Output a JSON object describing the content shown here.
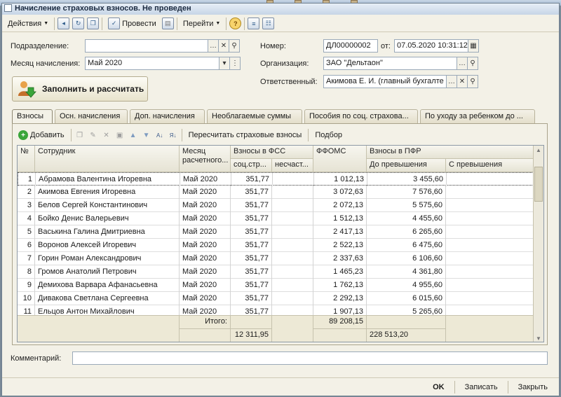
{
  "window": {
    "title": "Начисление страховых взносов. Не проведен"
  },
  "toolbar": {
    "actions_label": "Действия",
    "post_label": "Провести",
    "goto_label": "Перейти",
    "help_label": "?"
  },
  "form": {
    "division_label": "Подразделение:",
    "division_value": "",
    "month_label": "Месяц начисления:",
    "month_value": "Май 2020",
    "number_label": "Номер:",
    "number_value": "ДЛ00000002",
    "from_label": "от:",
    "date_value": "07.05.2020 10:31:12",
    "org_label": "Организация:",
    "org_value": "ЗАО \"Дельтаон\"",
    "resp_label": "Ответственный:",
    "resp_value": "Акимова Е. И. (главный бухгалте"
  },
  "fill_button": {
    "label": "Заполнить и рассчитать"
  },
  "tabs": [
    {
      "label": "Взносы"
    },
    {
      "label": "Осн. начисления"
    },
    {
      "label": "Доп. начисления"
    },
    {
      "label": "Необлагаемые суммы"
    },
    {
      "label": "Пособия по соц. страхова..."
    },
    {
      "label": "По уходу за ребенком до ..."
    }
  ],
  "subtoolbar": {
    "add_label": "Добавить",
    "recalc_label": "Пересчитать страховые взносы",
    "select_label": "Подбор"
  },
  "table": {
    "headers": {
      "num": "№",
      "employee": "Сотрудник",
      "month": "Месяц расчетного...",
      "fss": "Взносы в ФСС",
      "fss_sub1": "соц.стр...",
      "fss_sub2": "несчаст...",
      "ffoms": "ФФОМС",
      "pfr": "Взносы в ПФР",
      "pfr_sub1": "До превышения",
      "pfr_sub2": "С превышения"
    },
    "rows": [
      {
        "num": "1",
        "employee": "Абрамова Валентина Игоревна",
        "month": "Май 2020",
        "soc": "351,77",
        "nesch": "",
        "ffoms": "1 012,13",
        "pfr1": "3 455,60",
        "pfr2": ""
      },
      {
        "num": "2",
        "employee": "Акимова Евгения Игоревна",
        "month": "Май 2020",
        "soc": "351,77",
        "nesch": "",
        "ffoms": "3 072,63",
        "pfr1": "7 576,60",
        "pfr2": ""
      },
      {
        "num": "3",
        "employee": "Белов Сергей Константинович",
        "month": "Май 2020",
        "soc": "351,77",
        "nesch": "",
        "ffoms": "2 072,13",
        "pfr1": "5 575,60",
        "pfr2": ""
      },
      {
        "num": "4",
        "employee": "Бойко Денис Валерьевич",
        "month": "Май 2020",
        "soc": "351,77",
        "nesch": "",
        "ffoms": "1 512,13",
        "pfr1": "4 455,60",
        "pfr2": ""
      },
      {
        "num": "5",
        "employee": "Васькина Галина Дмитриевна",
        "month": "Май 2020",
        "soc": "351,77",
        "nesch": "",
        "ffoms": "2 417,13",
        "pfr1": "6 265,60",
        "pfr2": ""
      },
      {
        "num": "6",
        "employee": "Воронов Алексей Игоревич",
        "month": "Май 2020",
        "soc": "351,77",
        "nesch": "",
        "ffoms": "2 522,13",
        "pfr1": "6 475,60",
        "pfr2": ""
      },
      {
        "num": "7",
        "employee": "Горин Роман Александрович",
        "month": "Май 2020",
        "soc": "351,77",
        "nesch": "",
        "ffoms": "2 337,63",
        "pfr1": "6 106,60",
        "pfr2": ""
      },
      {
        "num": "8",
        "employee": "Громов Анатолий Петрович",
        "month": "Май 2020",
        "soc": "351,77",
        "nesch": "",
        "ffoms": "1 465,23",
        "pfr1": "4 361,80",
        "pfr2": ""
      },
      {
        "num": "9",
        "employee": "Демихова Варвара Афанасьевна",
        "month": "Май 2020",
        "soc": "351,77",
        "nesch": "",
        "ffoms": "1 762,13",
        "pfr1": "4 955,60",
        "pfr2": ""
      },
      {
        "num": "10",
        "employee": "Дивакова Светлана Сергеевна",
        "month": "Май 2020",
        "soc": "351,77",
        "nesch": "",
        "ffoms": "2 292,13",
        "pfr1": "6 015,60",
        "pfr2": ""
      },
      {
        "num": "11",
        "employee": "Ельцов Антон Михайлович",
        "month": "Май 2020",
        "soc": "351,77",
        "nesch": "",
        "ffoms": "1 907,13",
        "pfr1": "5 265,60",
        "pfr2": ""
      }
    ],
    "totals": {
      "label": "Итого:",
      "soc": "12 311,95",
      "ffoms": "89 208,15",
      "pfr1": "228 513,20"
    }
  },
  "comment": {
    "label": "Комментарий:",
    "value": ""
  },
  "bottom": {
    "ok_label": "OK",
    "save_label": "Записать",
    "close_label": "Закрыть"
  }
}
